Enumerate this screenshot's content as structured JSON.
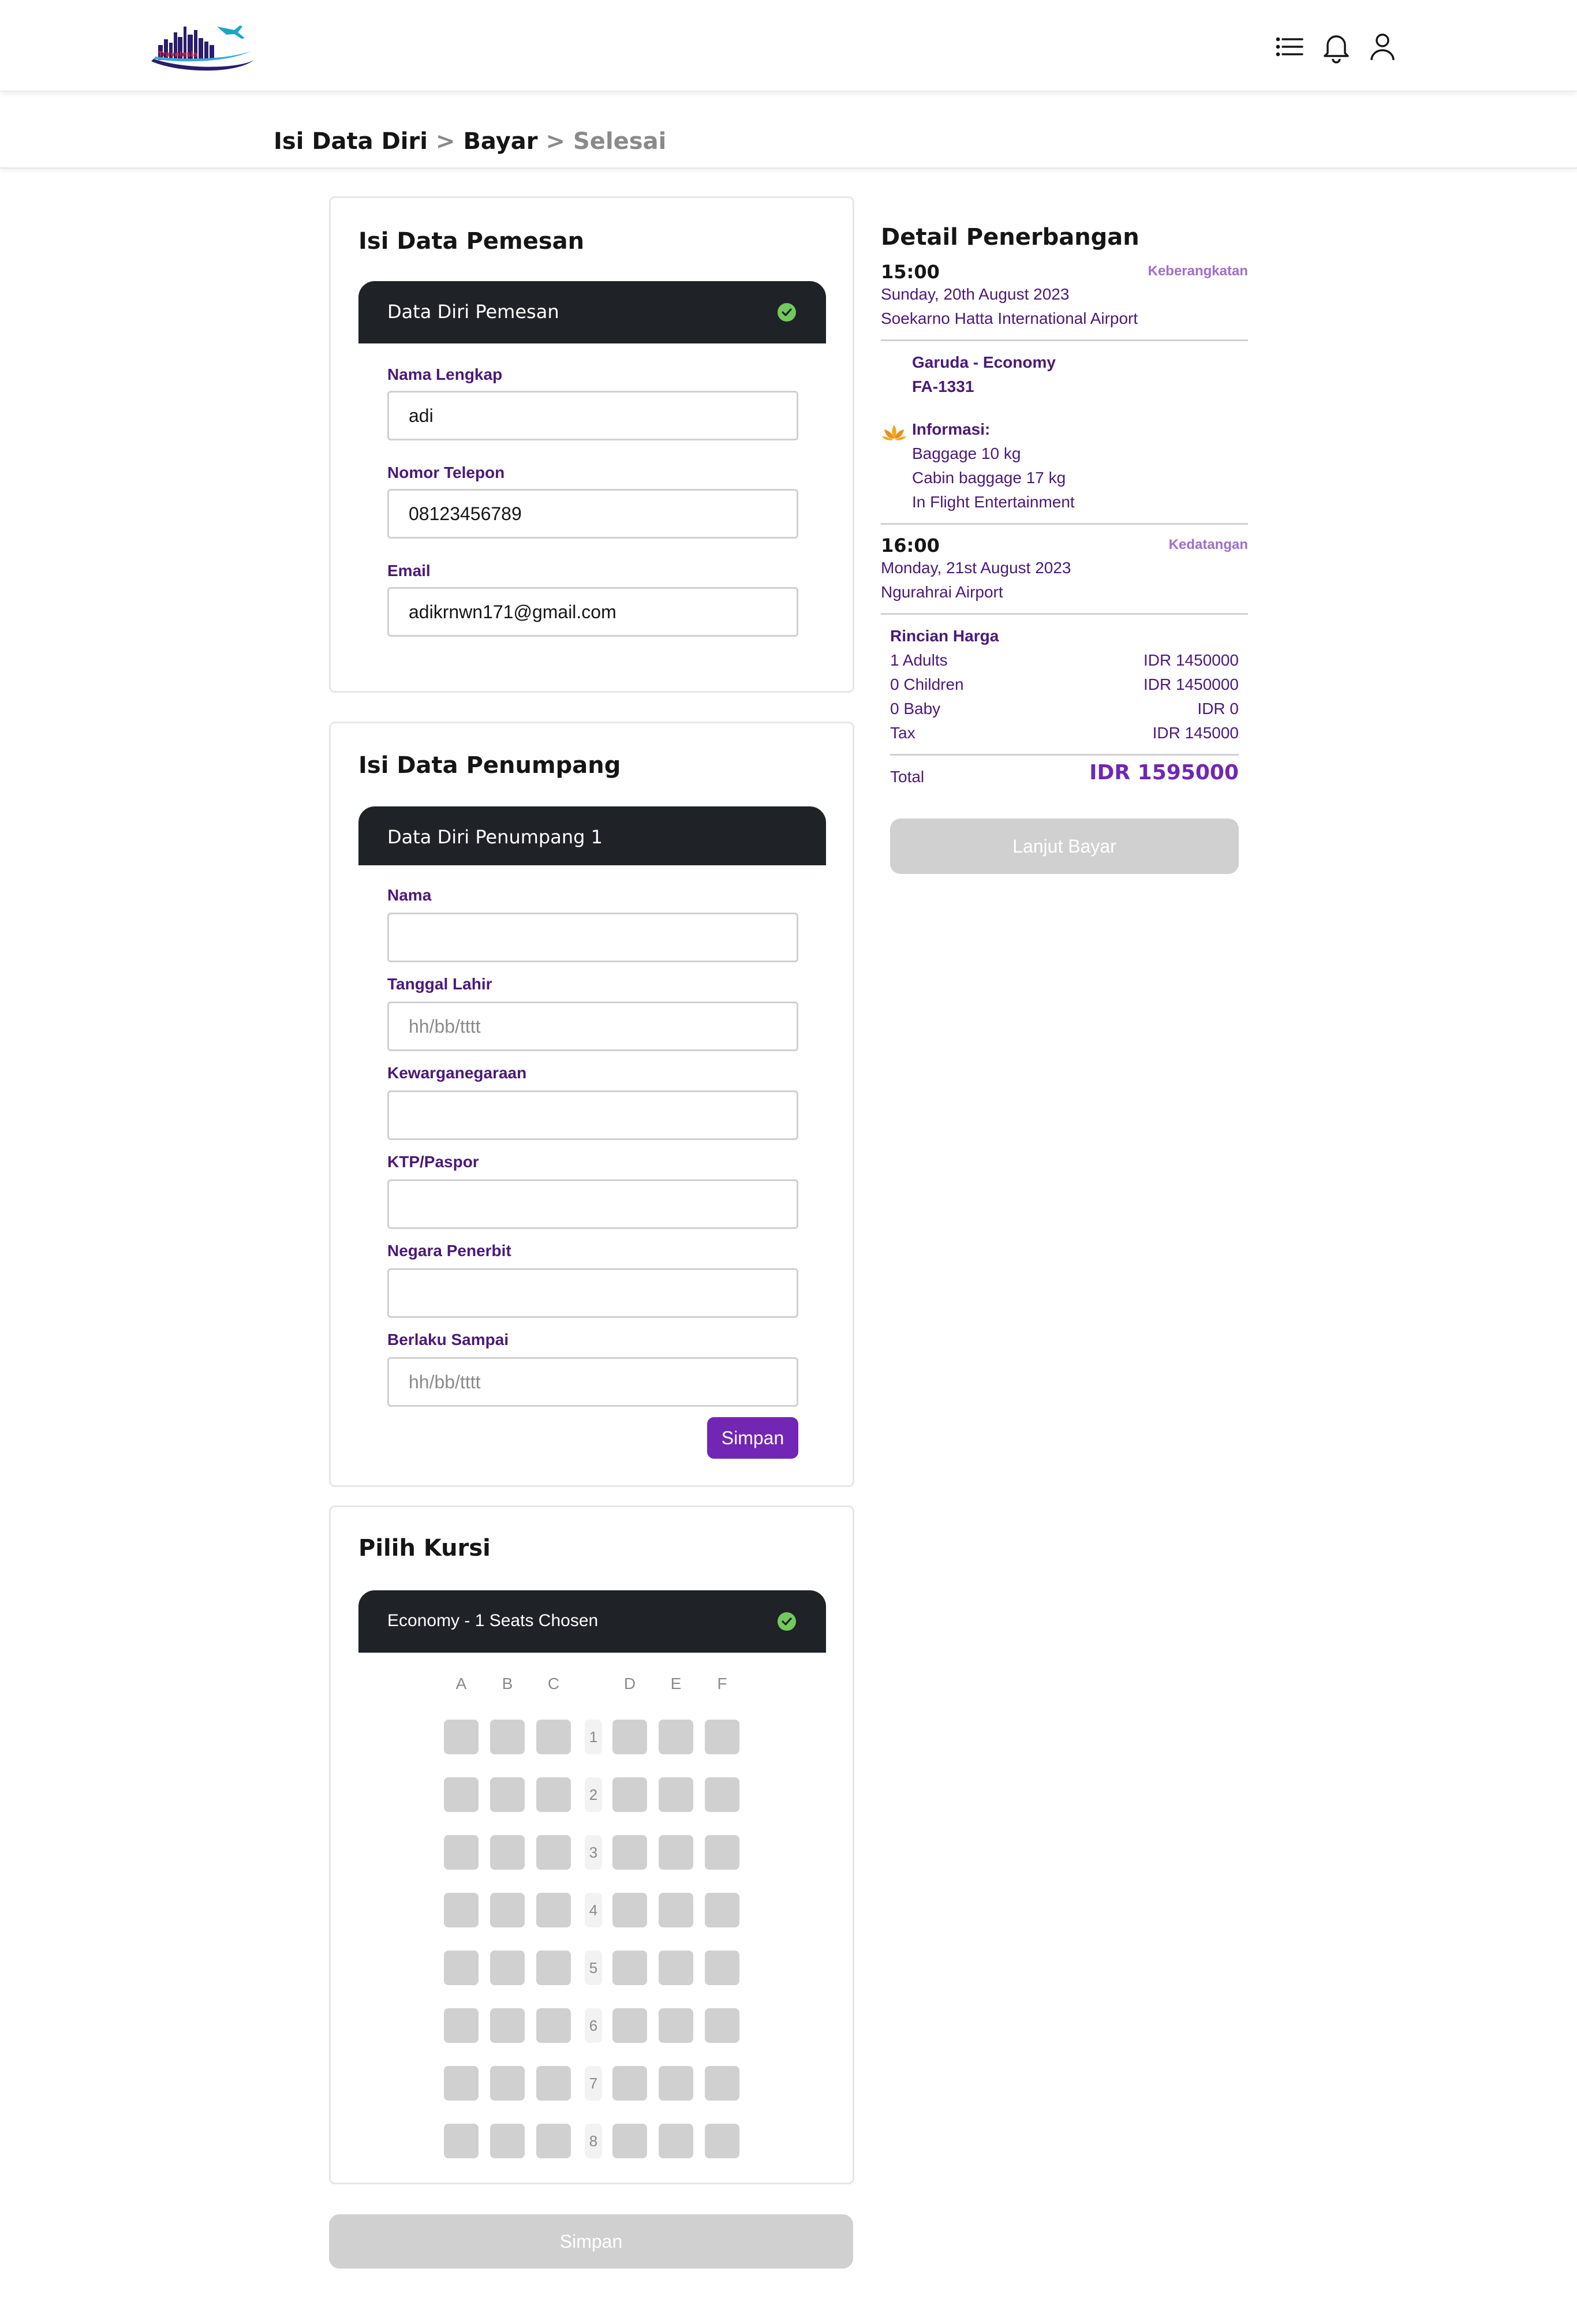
{
  "app": {
    "name": "Travelesia",
    "brand_color": "#7126b5"
  },
  "header": {
    "icons": [
      "list-icon",
      "bell-icon",
      "user-icon"
    ]
  },
  "breadcrumb": {
    "step1": "Isi Data Diri",
    "step2": "Bayar",
    "step3": "Selesai",
    "separator": ">"
  },
  "pemesan": {
    "title": "Isi Data Pemesan",
    "section_header": "Data Diri Pemesan",
    "fields": {
      "nama_label": "Nama Lengkap",
      "nama_value": "adi",
      "telp_label": "Nomor Telepon",
      "telp_value": "08123456789",
      "email_label": "Email",
      "email_value": "adikrnwn171@gmail.com"
    }
  },
  "penumpang": {
    "title": "Isi Data Penumpang",
    "section_header": "Data Diri Penumpang 1",
    "fields": {
      "nama_label": "Nama",
      "lahir_label": "Tanggal Lahir",
      "lahir_placeholder": "hh/bb/tttt",
      "warga_label": "Kewarganegaraan",
      "ktp_label": "KTP/Paspor",
      "negara_label": "Negara Penerbit",
      "berlaku_label": "Berlaku Sampai",
      "berlaku_placeholder": "hh/bb/tttt"
    },
    "save_label": "Simpan"
  },
  "kursi": {
    "title": "Pilih Kursi",
    "section_header": "Economy - 1 Seats Chosen",
    "columns_left": [
      "A",
      "B",
      "C"
    ],
    "columns_right": [
      "D",
      "E",
      "F"
    ],
    "rows": [
      "1",
      "2",
      "3",
      "4",
      "5",
      "6",
      "7",
      "8"
    ]
  },
  "bottom_save_label": "Simpan",
  "detail": {
    "title": "Detail Penerbangan",
    "departure": {
      "time": "15:00",
      "tag": "Keberangkatan",
      "date": "Sunday, 20th August 2023",
      "airport": "Soekarno Hatta International Airport"
    },
    "flight": {
      "airline": "Garuda - Economy",
      "code": "FA-1331"
    },
    "info": {
      "label": "Informasi:",
      "items": [
        "Baggage 10 kg",
        "Cabin baggage 17 kg",
        "In Flight Entertainment"
      ]
    },
    "arrival": {
      "time": "16:00",
      "tag": "Kedatangan",
      "date": "Monday, 21st August 2023",
      "airport": "Ngurahrai Airport"
    },
    "price": {
      "title": "Rincian Harga",
      "rows": [
        {
          "label": "1 Adults",
          "value": "IDR 1450000"
        },
        {
          "label": "0 Children",
          "value": "IDR 1450000"
        },
        {
          "label": "0 Baby",
          "value": "IDR 0"
        },
        {
          "label": "Tax",
          "value": "IDR 145000"
        }
      ],
      "total_label": "Total",
      "total_value": "IDR 1595000"
    },
    "pay_label": "Lanjut Bayar"
  }
}
